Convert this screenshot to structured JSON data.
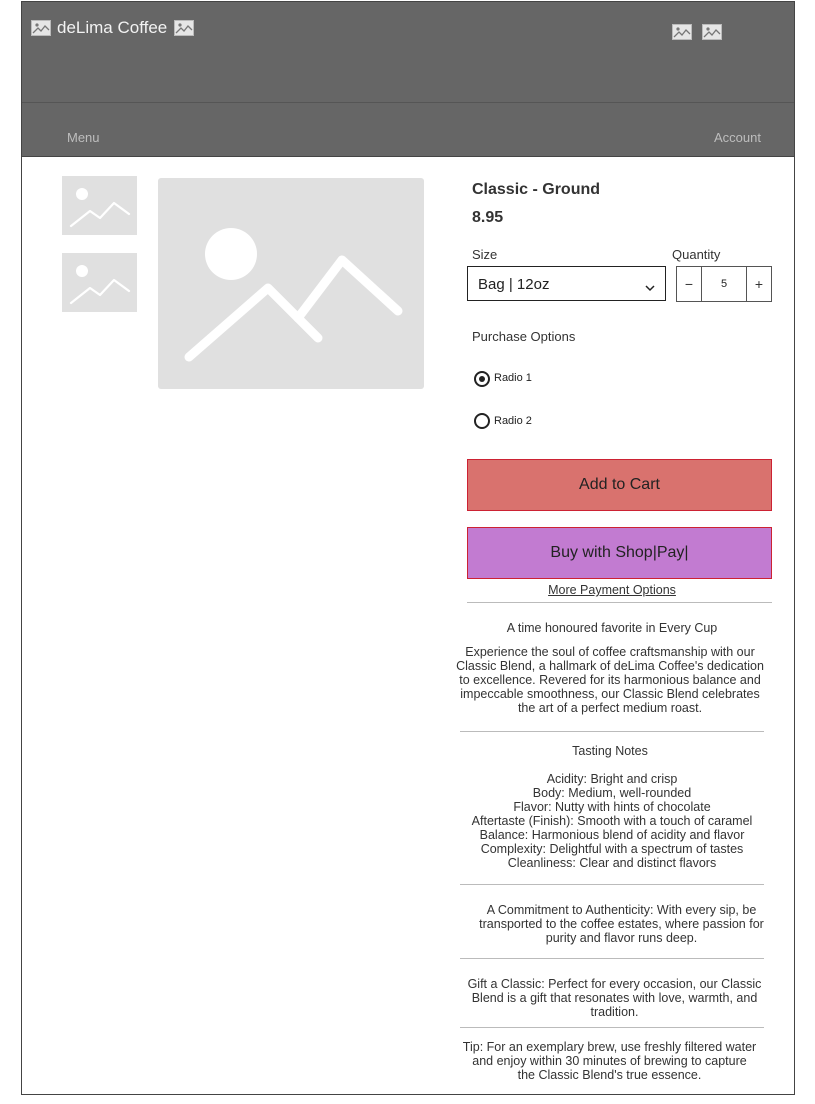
{
  "header": {
    "brand": "deLima Coffee",
    "icons": [
      "image-placeholder-icon",
      "image-placeholder-icon",
      "image-placeholder-icon",
      "image-placeholder-icon"
    ]
  },
  "nav": {
    "menu_label": "Menu",
    "account_label": "Account"
  },
  "product": {
    "title": "Classic - Ground",
    "price": "8.95",
    "size_label": "Size",
    "size_value": "Bag | 12oz",
    "quantity_label": "Quantity",
    "quantity_value": "5",
    "purchase_options_label": "Purchase Options",
    "radio_options": [
      {
        "label": "Radio 1",
        "selected": true
      },
      {
        "label": "Radio 2",
        "selected": false
      }
    ],
    "add_to_cart": "Add to Cart",
    "buy_shop_pay": "Buy with Shop|Pay|",
    "more_payment": "More Payment Options"
  },
  "description": {
    "headline": "A time honoured favorite in Every Cup",
    "intro": "Experience the soul of coffee craftsmanship with our Classic Blend, a hallmark of deLima Coffee's dedication to excellence. Revered for its harmonious balance and impeccable smoothness, our Classic Blend celebrates the art of a perfect medium roast.",
    "tasting_title": "Tasting Notes",
    "tasting_notes": [
      "Acidity: Bright and crisp",
      "Body: Medium, well-rounded",
      "Flavor: Nutty with hints of chocolate",
      "Aftertaste (Finish): Smooth with a touch of caramel",
      "Balance: Harmonious blend of acidity and flavor",
      "Complexity: Delightful with a spectrum of tastes",
      "Cleanliness: Clear and distinct flavors"
    ],
    "authenticity": "A Commitment to Authenticity: With every sip, be transported to the coffee estates, where passion for purity and flavor runs deep.",
    "gift": "Gift a Classic: Perfect for every occasion, our Classic Blend is a gift that resonates with love, warmth, and tradition.",
    "tip": "Tip: For an exemplary brew, use freshly filtered water and enjoy within 30 minutes of brewing to capture the Classic Blend's true essence."
  },
  "colors": {
    "header_bg": "#666666",
    "cart_button": "#d9726e",
    "shop_pay_button": "#c27bd1",
    "button_border": "#cc2233"
  }
}
